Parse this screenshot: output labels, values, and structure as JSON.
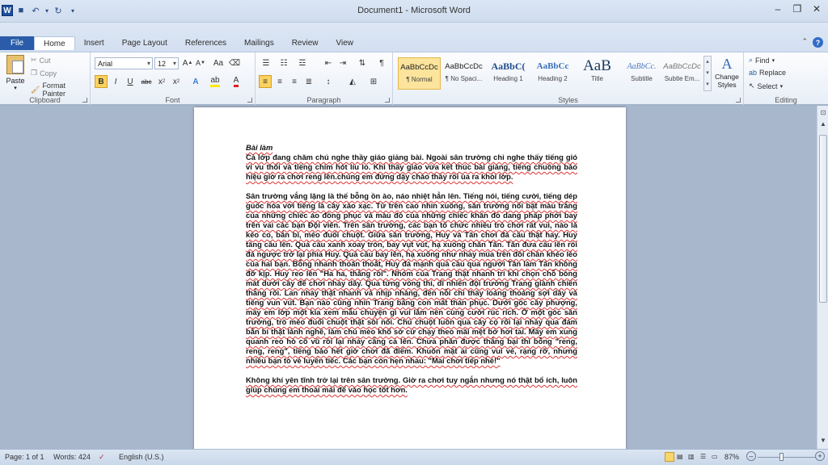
{
  "window": {
    "title": "Document1 - Microsoft Word"
  },
  "tabs": [
    "File",
    "Home",
    "Insert",
    "Page Layout",
    "References",
    "Mailings",
    "Review",
    "View"
  ],
  "clipboard": {
    "paste": "Paste",
    "cut": "Cut",
    "copy": "Copy",
    "format_painter": "Format Painter",
    "label": "Clipboard"
  },
  "font": {
    "name": "Arial",
    "size": "12",
    "label": "Font"
  },
  "paragraph": {
    "label": "Paragraph"
  },
  "styles": {
    "label": "Styles",
    "items": [
      {
        "preview": "AaBbCcDc",
        "name": "¶ Normal"
      },
      {
        "preview": "AaBbCcDc",
        "name": "¶ No Spaci..."
      },
      {
        "preview": "AaBbC(",
        "name": "Heading 1"
      },
      {
        "preview": "AaBbCc",
        "name": "Heading 2"
      },
      {
        "preview": "AaB",
        "name": "Title"
      },
      {
        "preview": "AaBbCc.",
        "name": "Subtitle"
      },
      {
        "preview": "AaBbCcDc",
        "name": "Subtle Em..."
      }
    ],
    "change_styles": "Change Styles"
  },
  "editing": {
    "find": "Find",
    "replace": "Replace",
    "select": "Select",
    "label": "Editing"
  },
  "document": {
    "heading": "Bài làm",
    "paragraphs": [
      "Cả lớp đang chăm chú nghe thầy giáo giảng bài. Ngoài sân trường chỉ nghe thấy tiếng gió vi vu thổi và tiếng chim hót líu lo. Khi thầy giáo vừa kết thúc bài giảng, tiếng chuông báo hiệu giờ ra chơi reng lên.chúng em đứng dậy chào thầy rồi ùa ra khỏi lớp.",
      "Sân trường vắng lặng là thế bỗng ồn ào, náo nhiệt hẳn lên. Tiếng nói, tiếng cười, tiếng dép guốc hòa với tiếng lá cây xào xạc. Từ trên cao nhìn xuống, sân trường nổi bật màu trắng của những chiếc áo đồng phục và màu đỏ của những chiếc khăn đỏ dang phấp phới bay trên vai các bạn Đội viên. Trên sân trường, các bạn tổ chức nhiều trò chơi rất vui, nào là kéo co, bắn bi, mèo đuổi chuột. Giữa sân trường, Huy và Tân chơi đá cầu thật hay. Huy tâng cầu lên. Quả cầu xanh xoay tròn, bay vụt vút, hạ xuống chân Tân. Tân đưa cầu lên rồi đá ngược trở lại phía Huy. Quả cầu bay lên, hạ xuống như nhảy múa trên đôi chân khéo léo của hai bạn. Bỗng nhanh thoăn thoắt, Huy đá mạnh quả cầu qua người Tân làm Tân không đỡ kịp. Huy reo lên \"Ha ha, thắng rồi\". Nhóm của Trang thật nhanh trí khi chọn chỗ bóng mát dưới cây để chơi nhảy dây. Qua từng vòng thi, dĩ nhiên đội trưởng Trang giành chiến thắng rồi. Lan nhảy thật nhanh và nhịp nhàng, đến nỗi chỉ thấy loáng thoáng sợi dây và tiếng vun vút. Bạn nào cũng nhìn Trang bằng con mắt thán phục. Dưới gốc cây phượng, mấy em lớp một kia xem mẫu chuyện gì vui lắm nên cùng cười rúc rích. Ở một góc sân trường, trò mèo đuổi chuột thật sôi nổi. Chú chuột luôn qua cây cọ rồi lại nhảy qua đám bắn bi thật lành nghề, làm chú mèo khổ sở cứ chạy theo mãi mệt bở hơi tai. Mấy em xung quanh reo hò cổ vũ rồi lại nhảy cẵng cả lên. Chưa phân được thắng bại thì bỗng \"reng, reng, reng\", tiếng báo hết giờ chơi đã điểm. Khuôn mặt ai cũng vui vẻ, rạng rỡ, nhưng nhiều bạn tỏ vẻ luyến tiếc. Các bạn còn hẹn nhau: \"Mai chơi tiếp nhé!\"",
      "Không khí yên tĩnh trở lại trên sân trường. Giờ ra chơi tuy ngắn nhưng nó thật bổ ích, luôn giúp chúng em thoải mái để vào học tốt hơn."
    ]
  },
  "status": {
    "page": "Page: 1 of 1",
    "words": "Words: 424",
    "language": "English (U.S.)",
    "zoom": "87%"
  },
  "colors": {
    "file_tab": "#2a5caa",
    "highlight": "#fbd25e",
    "spell_underline": "#d33"
  }
}
